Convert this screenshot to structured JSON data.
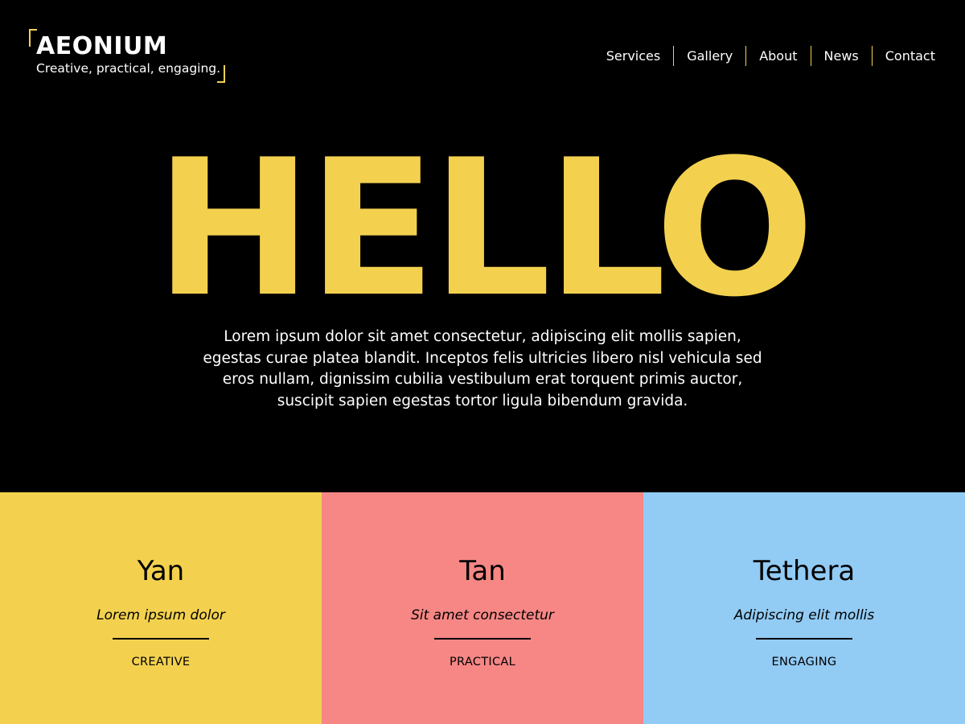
{
  "brand": {
    "name": "AEONIUM",
    "tagline": "Creative, practical, engaging."
  },
  "nav": {
    "items": [
      "Services",
      "Gallery",
      "About",
      "News",
      "Contact"
    ]
  },
  "hero": {
    "title": "HELLO",
    "body": "Lorem ipsum dolor sit amet consectetur, adipiscing elit mollis sapien, egestas curae platea blandit. Inceptos felis ultricies libero nisl vehicula sed eros nullam, dignissim cubilia vestibulum erat torquent primis auctor, suscipit sapien egestas tortor ligula bibendum gravida."
  },
  "cards": [
    {
      "title": "Yan",
      "subtitle": "Lorem ipsum dolor",
      "tag": "CREATIVE",
      "color": "#f3d14f"
    },
    {
      "title": "Tan",
      "subtitle": "Sit amet consectetur",
      "tag": "PRACTICAL",
      "color": "#f68785"
    },
    {
      "title": "Tethera",
      "subtitle": "Adipiscing elit mollis",
      "tag": "ENGAGING",
      "color": "#92cbf4"
    }
  ],
  "colors": {
    "background": "#000000",
    "accent": "#f3d14f",
    "text": "#ffffff"
  }
}
